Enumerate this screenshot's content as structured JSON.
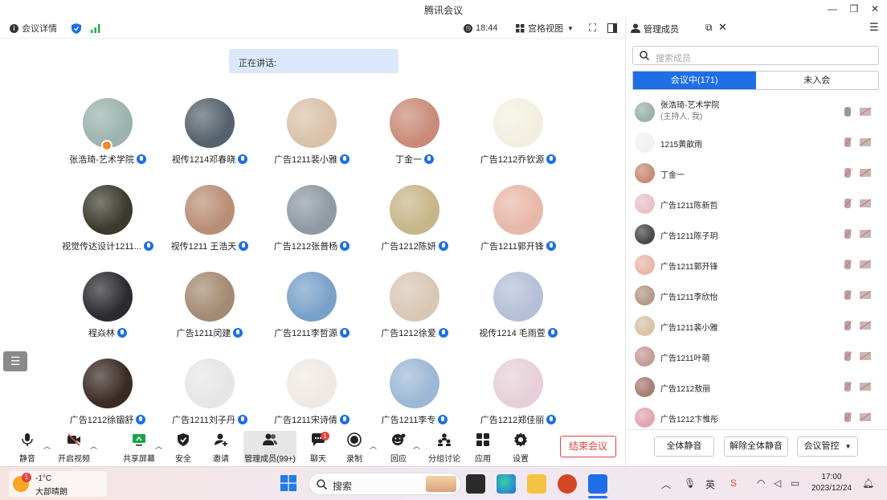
{
  "window": {
    "title": "腾讯会议"
  },
  "topbar": {
    "meeting_details": "会议详情",
    "time": "18:44",
    "grid_view": "宫格视图"
  },
  "main": {
    "speaking_label": "正在讲话:",
    "participants": [
      {
        "name": "张浩琦-艺术学院",
        "avatar_color": "#9bb2ad",
        "host": true
      },
      {
        "name": "视传1214邓春晓",
        "avatar_color": "#55626c"
      },
      {
        "name": "广告1211裴小雅",
        "avatar_color": "#d9c2a8"
      },
      {
        "name": "丁金一",
        "avatar_color": "#c98b78"
      },
      {
        "name": "广告1212乔钦源",
        "avatar_color": "#f3efe0"
      },
      {
        "name": "视觉传达设计1211...",
        "avatar_color": "#3c3a2e"
      },
      {
        "name": "视传1211 王浩天",
        "avatar_color": "#b98e76"
      },
      {
        "name": "广告1212张普杨",
        "avatar_color": "#8e9aa4"
      },
      {
        "name": "广告1212陈妍",
        "avatar_color": "#c7b689"
      },
      {
        "name": "广告1211郭开锋",
        "avatar_color": "#e8b8a8"
      },
      {
        "name": "程焱林",
        "avatar_color": "#2a2a30"
      },
      {
        "name": "广告1211闵建",
        "avatar_color": "#a48a72"
      },
      {
        "name": "广告1211李哲源",
        "avatar_color": "#7aa1c9"
      },
      {
        "name": "广告1212徐爱",
        "avatar_color": "#d8c7b4"
      },
      {
        "name": "视传1214 毛雨萱",
        "avatar_color": "#b6bfd8"
      },
      {
        "name": "广告1212徐锢舒",
        "avatar_color": "#3a2a24"
      },
      {
        "name": "广告1211刘子丹",
        "avatar_color": "#e6e6e6"
      },
      {
        "name": "广告1211宋诗倩",
        "avatar_color": "#efe9e4"
      },
      {
        "name": "广告1211李专",
        "avatar_color": "#9cb8d6"
      },
      {
        "name": "广告1212郑佳丽",
        "avatar_color": "#e6cfd8"
      }
    ]
  },
  "bottombar": {
    "mute": "静音",
    "video": "开启视频",
    "share": "共享屏幕",
    "security": "安全",
    "invite": "邀请",
    "members": "管理成员(99+)",
    "chat": "聊天",
    "chat_badge": "1",
    "record": "录制",
    "reactions": "回应",
    "breakout": "分组讨论",
    "apps": "应用",
    "settings": "设置",
    "end_meeting": "结束会议"
  },
  "panel": {
    "title": "管理成员",
    "search_placeholder": "搜索成员",
    "tab_in_meeting": "会议中(171)",
    "tab_not_joined": "未入会",
    "members": [
      {
        "name": "张浩琦-艺术学院",
        "sub": "(主持人, 我)",
        "avatar_color": "#9bb2ad",
        "mic_on": true
      },
      {
        "name": "1215黄歆雨",
        "avatar_color": "#f1f1f1"
      },
      {
        "name": "丁金一",
        "avatar_color": "#c98b78"
      },
      {
        "name": "广告1211陈新哲",
        "avatar_color": "#e9c2c8"
      },
      {
        "name": "广告1211陈子玥",
        "avatar_color": "#4a4a4a"
      },
      {
        "name": "广告1211郭开锋",
        "avatar_color": "#e8b8a8"
      },
      {
        "name": "广告1211李欣怡",
        "avatar_color": "#b59a87"
      },
      {
        "name": "广告1211裴小雅",
        "avatar_color": "#d9c2a8"
      },
      {
        "name": "广告1211叶萌",
        "avatar_color": "#c59b9b"
      },
      {
        "name": "广告1212敖丽",
        "avatar_color": "#a87d74"
      },
      {
        "name": "广告1212卞惟彤",
        "avatar_color": "#e3a6b1"
      }
    ],
    "mute_all": "全体静音",
    "unmute_all": "解除全体静音",
    "control": "会议管控"
  },
  "taskbar": {
    "weather_badge": "1",
    "temperature": "-1°C",
    "weather": "大部晴朗",
    "search": "搜索",
    "time": "17:00",
    "date": "2023/12/24"
  }
}
